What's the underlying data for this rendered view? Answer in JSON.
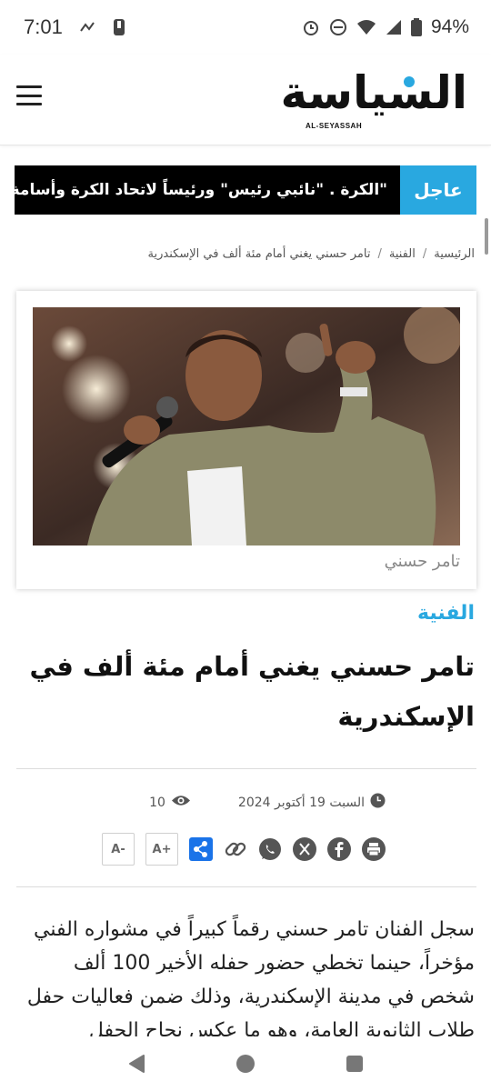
{
  "status_bar": {
    "time": "7:01",
    "battery": "94%",
    "icons": [
      "nfc-icon",
      "phone-alert-icon",
      "alarm-icon",
      "do-not-disturb-icon",
      "wifi-icon",
      "signal-icon",
      "battery-icon"
    ]
  },
  "header": {
    "logo_ar": "السياسة",
    "logo_en": "AL-SEYASSAH",
    "menu_icon": "hamburger-icon"
  },
  "ticker": {
    "label": "عاجل",
    "text": "\"الكرة   .   \"نائبي رئيس\" ورئيساً لاتحاد الكرة وأسامة ومبارك"
  },
  "breadcrumb": {
    "home": "الرئيسية",
    "section": "الفنية",
    "current": "تامر حسني يغني أمام مئة ألف في الإسكندرية"
  },
  "image": {
    "caption": "تامر حسني"
  },
  "article": {
    "category": "الفنية",
    "title": "تامر حسني يغني أمام مئة ألف في الإسكندرية",
    "date": "السبت 19 أكتوبر 2024",
    "views": "10",
    "font_increase": "A+",
    "font_decrease": "A-",
    "body": "سجل الفنان تامر حسني رقماً كبيراً في مشواره الفني مؤخراً، حينما تخطي حضور حفله الأخير 100 ألف شخص في مدينة الإسكندرية، وذلك ضمن فعاليات حفل طلاب الثانوية العامة، وهو ما عكس نجاح الحفل"
  },
  "colors": {
    "accent": "#29a8e0",
    "ticker_bg": "#000000",
    "share_blue": "#1a73e8"
  }
}
